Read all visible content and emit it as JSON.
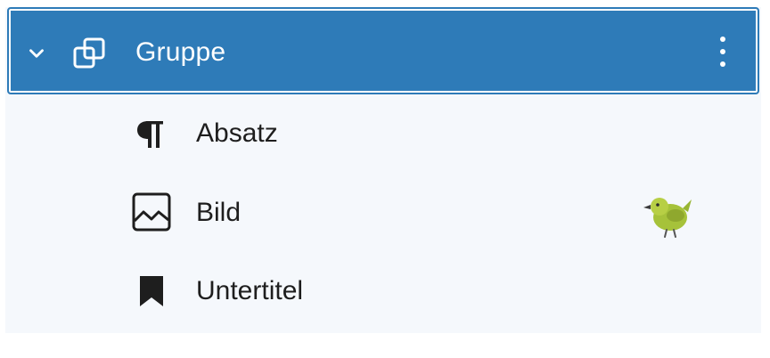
{
  "list_view": {
    "parent": {
      "label": "Gruppe",
      "icon": "group-icon",
      "expanded": true,
      "selected": true,
      "options_icon": "more-vertical-icon"
    },
    "children": [
      {
        "label": "Absatz",
        "icon": "paragraph-icon"
      },
      {
        "label": "Bild",
        "icon": "image-icon",
        "badge_icon": "bird-icon"
      },
      {
        "label": "Untertitel",
        "icon": "bookmark-icon"
      }
    ]
  },
  "colors": {
    "selected_bg": "#2e7bb8",
    "panel_bg": "#f5f8fc",
    "text": "#1e1e1e",
    "selected_text": "#ffffff"
  }
}
